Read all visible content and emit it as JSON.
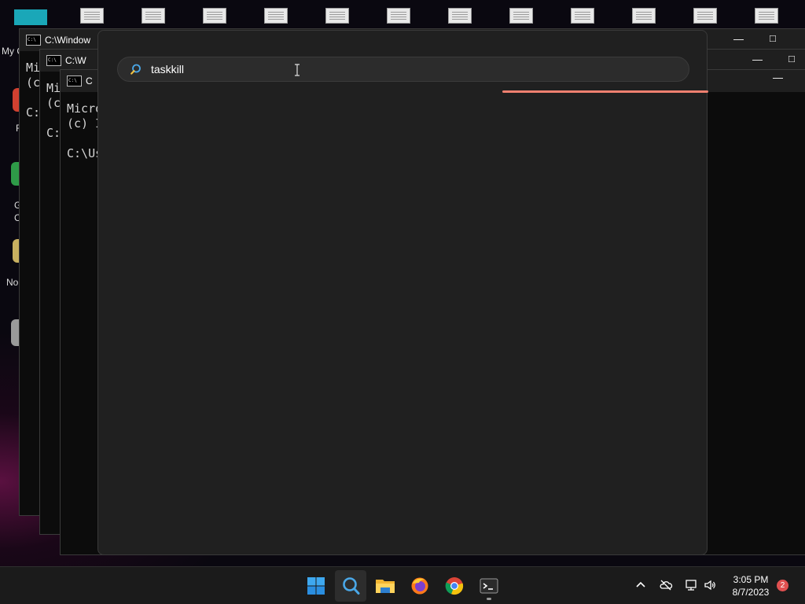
{
  "desktop": {
    "icon_label_my_computer": "My C",
    "side_labels": [
      "F",
      "G",
      "C",
      "No"
    ]
  },
  "cmd_windows": [
    {
      "title": "C:\\Window",
      "lines": [
        "Mi",
        "(c",
        "",
        "C:"
      ]
    },
    {
      "title": "C:\\W",
      "lines": [
        "Mi",
        "(c",
        "",
        "C:"
      ]
    },
    {
      "title": "C",
      "lines": [
        "Micro",
        "(c) I",
        "",
        "C:\\Us"
      ]
    }
  ],
  "search": {
    "query": "taskkill",
    "progress_color": "#f08070"
  },
  "taskbar": {
    "icons": [
      "windows-start-icon",
      "search-icon",
      "file-explorer-icon",
      "firefox-icon",
      "chrome-icon",
      "terminal-icon"
    ],
    "tray": [
      "chevron-up-icon",
      "onedrive-offline-icon",
      "network-icon",
      "volume-icon"
    ],
    "time": "3:05 PM",
    "date": "8/7/2023",
    "notification_count": "2"
  }
}
